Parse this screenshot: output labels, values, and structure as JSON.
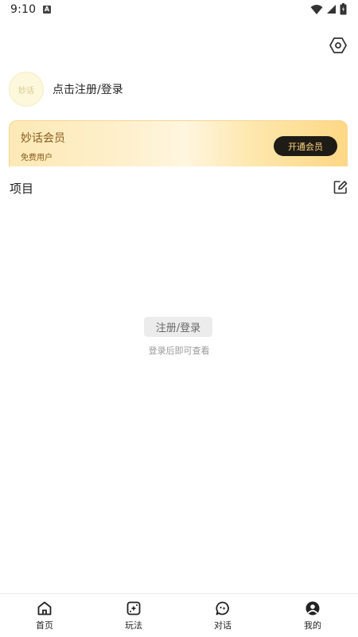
{
  "status_bar": {
    "time": "9:10",
    "notification_icon_letter": "A",
    "icons": [
      "wifi-icon",
      "signal-icon",
      "battery-icon"
    ]
  },
  "header": {
    "settings_icon": "settings-hexagon-icon"
  },
  "profile": {
    "avatar_text": "妙话",
    "login_text": "点击注册/登录"
  },
  "vip": {
    "title": "妙话会员",
    "subtitle": "免费用户",
    "button_label": "开通会员",
    "button_text_color": "#fcd87d"
  },
  "projects": {
    "title": "项目",
    "edit_icon": "edit-icon"
  },
  "empty_state": {
    "login_button": "注册/登录",
    "hint": "登录后即可查看"
  },
  "tabs": [
    {
      "label": "首页",
      "icon": "home-icon"
    },
    {
      "label": "玩法",
      "icon": "dice-icon"
    },
    {
      "label": "对话",
      "icon": "chat-icon"
    },
    {
      "label": "我的",
      "icon": "profile-icon"
    }
  ],
  "colors": {
    "accent_gold": "#fdd885",
    "vip_text": "#8a5a1c",
    "dark_button": "#1f1b16"
  }
}
